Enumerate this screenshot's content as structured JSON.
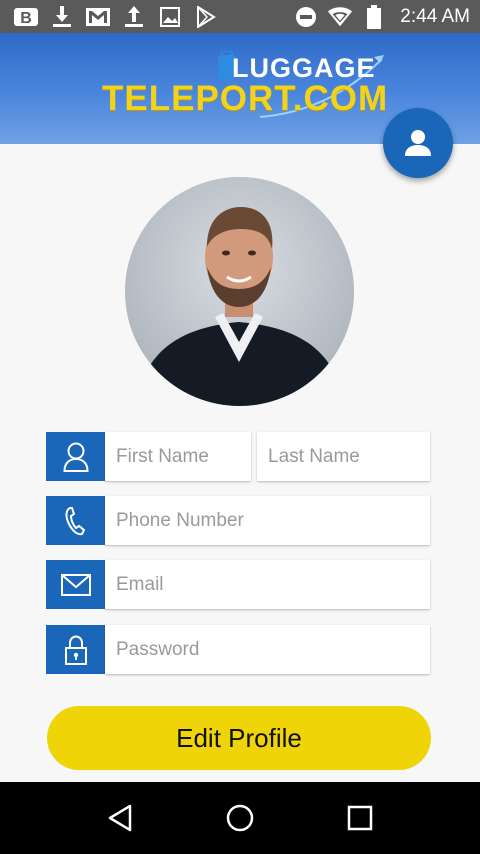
{
  "status_bar": {
    "time": "2:44 AM",
    "left_icons": [
      "b-app-icon",
      "download-icon",
      "gmail-icon",
      "upload-icon",
      "image-icon",
      "play-store-icon"
    ],
    "right_icons": [
      "do-not-disturb-icon",
      "wifi-icon",
      "battery-icon"
    ]
  },
  "header": {
    "logo_top": "LUGGAGE",
    "logo_bottom": "TELEPORT.COM",
    "brand_color": "#2f6ac8",
    "logo_yellow": "#f3d21c"
  },
  "form": {
    "first_name": {
      "placeholder": "First Name",
      "value": ""
    },
    "last_name": {
      "placeholder": "Last Name",
      "value": ""
    },
    "phone": {
      "placeholder": "Phone Number",
      "value": ""
    },
    "email": {
      "placeholder": "Email",
      "value": ""
    },
    "password": {
      "placeholder": "Password",
      "value": ""
    }
  },
  "actions": {
    "edit_profile_label": "Edit Profile",
    "button_color": "#efd508"
  },
  "icons": {
    "fab": "profile-icon",
    "first_name": "person-icon",
    "phone": "phone-icon",
    "email": "envelope-icon",
    "password": "lock-icon"
  },
  "nav": [
    "back-icon",
    "home-icon",
    "recents-icon"
  ]
}
